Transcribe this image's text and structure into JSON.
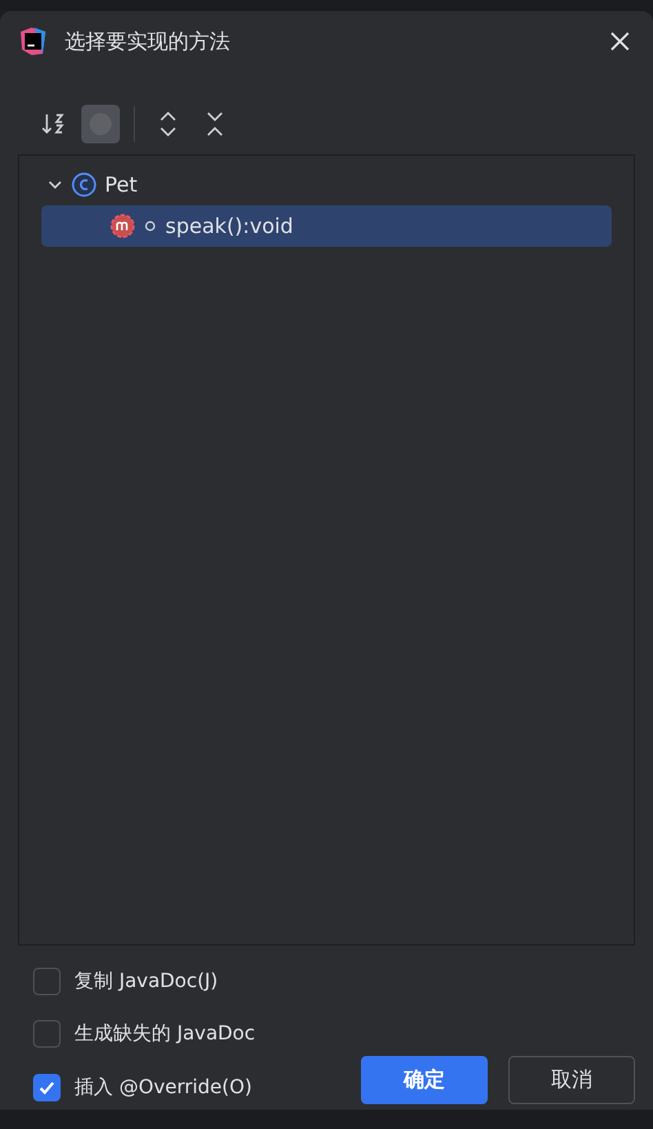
{
  "window": {
    "title": "选择要实现的方法"
  },
  "toolbar": [
    {
      "kind": "sort",
      "selected": false
    },
    {
      "kind": "visibility",
      "selected": true
    },
    {
      "kind": "expand",
      "selected": false
    },
    {
      "kind": "collapse",
      "selected": false
    }
  ],
  "tree": [
    {
      "kind": "class",
      "label": "Pet",
      "expanded": true,
      "selected": false,
      "children": [
        {
          "kind": "method",
          "label": "speak():void",
          "selected": true
        }
      ]
    }
  ],
  "options": [
    {
      "label": "复制 JavaDoc(J)",
      "checked": false
    },
    {
      "label": "生成缺失的 JavaDoc",
      "checked": false
    },
    {
      "label": "插入 @Override(O)",
      "checked": true
    }
  ],
  "buttons": [
    {
      "label": "确定",
      "kind": "primary"
    },
    {
      "label": "取消",
      "kind": "secondary"
    }
  ]
}
